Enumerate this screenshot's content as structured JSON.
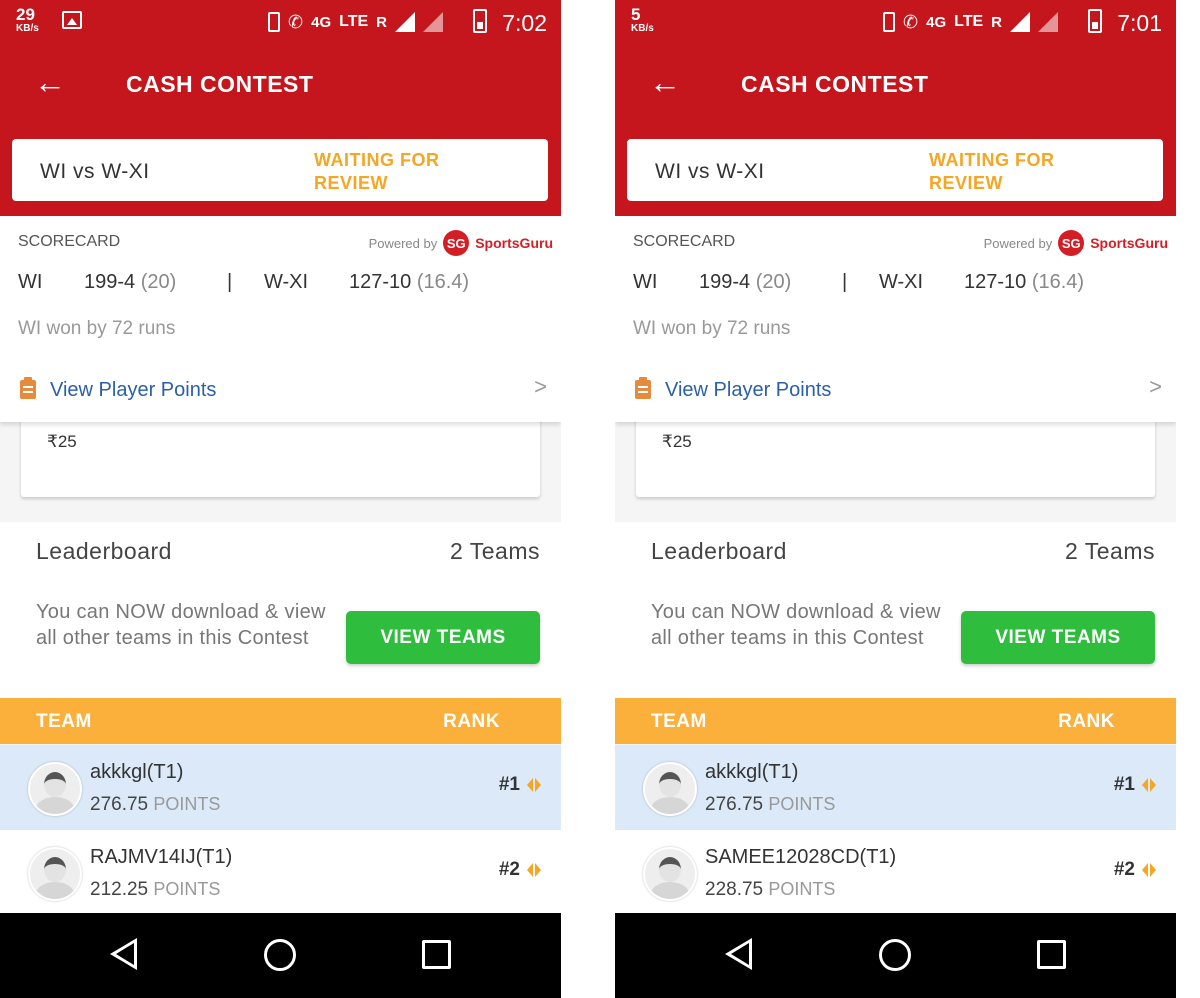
{
  "screens": [
    {
      "status": {
        "speed_value": "29",
        "speed_unit": "KB/s",
        "network_label": "4G",
        "lte_label": "LTE",
        "roaming_label": "R",
        "time": "7:02"
      },
      "header": {
        "title": "CASH CONTEST"
      },
      "match": {
        "name": "WI vs W-XI",
        "status": "WAITING FOR REVIEW"
      },
      "scorecard": {
        "title": "SCORECARD",
        "powered_by": "Powered by",
        "brand_badge": "SG",
        "brand_name": "SportsGuru",
        "team1": "WI",
        "score1": "199-4",
        "overs1": "(20)",
        "separator": "|",
        "team2": "W-XI",
        "score2": "127-10",
        "overs2": "(16.4)",
        "result": "WI won by 72 runs"
      },
      "view_player_points": {
        "label": "View Player Points",
        "chevron": ">"
      },
      "prize": {
        "amount": "₹25"
      },
      "leaderboard": {
        "title": "Leaderboard",
        "count": "2 Teams",
        "description": "You can NOW download & view all other teams in this Contest",
        "button": "VIEW TEAMS",
        "col_team": "TEAM",
        "col_rank": "RANK",
        "rows": [
          {
            "name": "akkkgl",
            "tag": "(T1)",
            "points": "276.75",
            "points_label": "POINTS",
            "rank": "#1"
          },
          {
            "name": "RAJMV14IJ",
            "tag": "(T1)",
            "points": "212.25",
            "points_label": "POINTS",
            "rank": "#2"
          }
        ]
      }
    },
    {
      "status": {
        "speed_value": "5",
        "speed_unit": "KB/s",
        "network_label": "4G",
        "lte_label": "LTE",
        "roaming_label": "R",
        "time": "7:01"
      },
      "header": {
        "title": "CASH CONTEST"
      },
      "match": {
        "name": "WI vs W-XI",
        "status": "WAITING FOR REVIEW"
      },
      "scorecard": {
        "title": "SCORECARD",
        "powered_by": "Powered by",
        "brand_badge": "SG",
        "brand_name": "SportsGuru",
        "team1": "WI",
        "score1": "199-4",
        "overs1": "(20)",
        "separator": "|",
        "team2": "W-XI",
        "score2": "127-10",
        "overs2": "(16.4)",
        "result": "WI won by 72 runs"
      },
      "view_player_points": {
        "label": "View Player Points",
        "chevron": ">"
      },
      "prize": {
        "amount": "₹25"
      },
      "leaderboard": {
        "title": "Leaderboard",
        "count": "2 Teams",
        "description": "You can NOW download & view all other teams in this Contest",
        "button": "VIEW TEAMS",
        "col_team": "TEAM",
        "col_rank": "RANK",
        "rows": [
          {
            "name": "akkkgl",
            "tag": "(T1)",
            "points": "276.75",
            "points_label": "POINTS",
            "rank": "#1"
          },
          {
            "name": "SAMEE12028CD",
            "tag": "(T1)",
            "points": "228.75",
            "points_label": "POINTS",
            "rank": "#2"
          }
        ]
      }
    }
  ],
  "colors": {
    "primary_red": "#c4161c",
    "accent_orange": "#f5a623",
    "table_header": "#fbb03b",
    "button_green": "#2ebd3c",
    "link_blue": "#2b5fa8",
    "highlight_row": "#dbe9f8"
  },
  "icons": {
    "back": "left-arrow",
    "list": "clipboard",
    "rank": "left-right-arrows",
    "nav": [
      "back-triangle",
      "home-circle",
      "recent-square"
    ]
  }
}
